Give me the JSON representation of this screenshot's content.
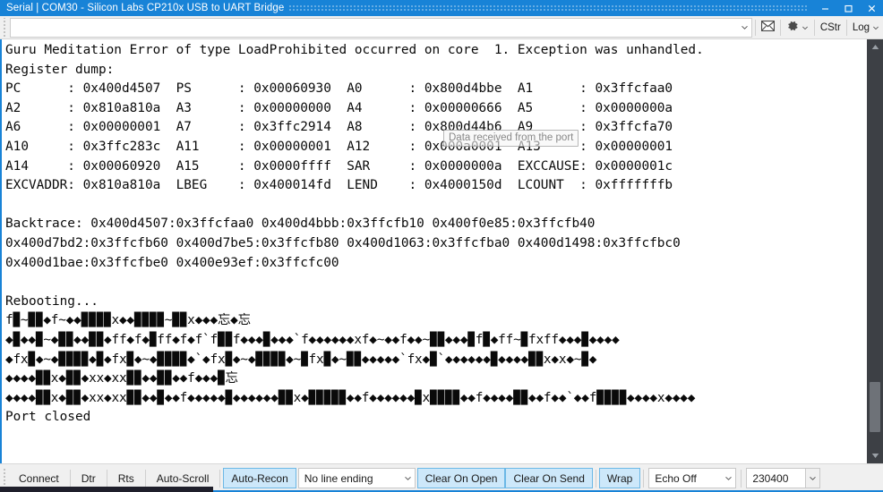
{
  "window": {
    "title": "Serial | COM30 - Silicon Labs CP210x USB to UART Bridge",
    "minimize_label": "‒",
    "maximize_label": "❐",
    "close_label": "✕"
  },
  "toolbar": {
    "send_value": "",
    "send_placeholder": "",
    "combo_arrow": "▾",
    "mail_icon_name": "envelope-icon",
    "gear_icon_name": "gear-icon",
    "gear_arrow": "▾",
    "cstr_label": "CStr",
    "log_label": "Log",
    "log_arrow": "▾"
  },
  "terminal": {
    "tooltip": "Data received from the port",
    "lines": [
      "Guru Meditation Error of type LoadProhibited occurred on core  1. Exception was unhandled.",
      "Register dump:",
      "PC      : 0x400d4507  PS      : 0x00060930  A0      : 0x800d4bbe  A1      : 0x3ffcfaa0",
      "A2      : 0x810a810a  A3      : 0x00000000  A4      : 0x00000666  A5      : 0x0000000a",
      "A6      : 0x00000001  A7      : 0x3ffc2914  A8      : 0x800d44b6  A9      : 0x3ffcfa70",
      "A10     : 0x3ffc283c  A11     : 0x00000001  A12     : 0x000a0001  A13     : 0x00000001",
      "A14     : 0x00060920  A15     : 0x0000ffff  SAR     : 0x0000000a  EXCCAUSE: 0x0000001c",
      "EXCVADDR: 0x810a810a  LBEG    : 0x400014fd  LEND    : 0x4000150d  LCOUNT  : 0xfffffffb",
      "",
      "Backtrace: 0x400d4507:0x3ffcfaa0 0x400d4bbb:0x3ffcfb10 0x400f0e85:0x3ffcfb40",
      "0x400d7bd2:0x3ffcfb60 0x400d7be5:0x3ffcfb80 0x400d1063:0x3ffcfba0 0x400d1498:0x3ffcfbc0",
      "0x400d1bae:0x3ffcfbe0 0x400e93ef:0x3ffcfc00",
      "",
      "Rebooting..."
    ],
    "garbled_lines": [
      "f▉~▉▉◆f~◆◆▉▉▉▉x◆◆▉▉▉▉~▉▉x◆◆◆忘◆忘",
      "◆▉◆◆▉~◆▉▉◆◆▉▉◆ff◆f◆▉ff◆f◆f`f▉▉f◆◆◆▉◆◆◆`f◆◆◆◆◆◆xf◆~◆◆f◆◆~▉▉◆◆◆▉f▉◆ff~▉fxff◆◆◆▉◆◆◆◆",
      "◆fx▉◆~◆▉▉▉▉◆▉◆fx▉◆~◆▉▉▉▉◆`◆fx▉◆~◆▉▉▉▉◆~▉fx▉◆~▉▉◆◆◆◆◆`fx◆▉`◆◆◆◆◆◆▉◆◆◆◆▉▉x◆x◆~▉◆",
      "◆◆◆◆▉▉x◆▉▉◆xx◆xx▉▉◆◆▉▉◆◆f◆◆◆▉忘",
      "◆◆◆◆▉▉x◆▉▉◆xx◆xx▉▉◆◆▉◆◆f◆◆◆◆◆▉◆◆◆◆◆◆▉▉x◆▉▉▉▉▉◆◆f◆◆◆◆◆◆▉x▉▉▉▉◆◆f◆◆◆◆▉▉◆◆f◆◆`◆◆f▉▉▉▉◆◆◆◆x◆◆◆◆"
    ],
    "final_line": "Port closed"
  },
  "scrollbar": {
    "up_arrow": "▲",
    "down_arrow": "▼"
  },
  "bottombar": {
    "buttons": [
      {
        "label": "Connect",
        "active": false,
        "name": "connect-button"
      },
      {
        "label": "Dtr",
        "active": false,
        "name": "dtr-button"
      },
      {
        "label": "Rts",
        "active": false,
        "name": "rts-button"
      },
      {
        "label": "Auto-Scroll",
        "active": false,
        "name": "auto-scroll-button"
      },
      {
        "label": "Auto-Recon",
        "active": true,
        "name": "auto-reconnect-button"
      }
    ],
    "line_ending": {
      "value": "No line ending",
      "arrow": "▾"
    },
    "clear_on_open": {
      "label": "Clear On Open",
      "active": true
    },
    "clear_on_send": {
      "label": "Clear On Send",
      "active": true
    },
    "wrap": {
      "label": "Wrap",
      "active": true
    },
    "echo": {
      "value": "Echo Off",
      "arrow": "▾"
    },
    "baud": {
      "value": "230400",
      "arrow": "▾"
    }
  },
  "colors": {
    "titlebar": "#1883d7",
    "accent": "#1883d7",
    "toolbar_bg": "#f0f0f0",
    "active_btn": "#cde8fa",
    "scrollbar_bg": "#3d4045",
    "scrollbar_thumb": "#6e7278",
    "terminal_text": "#0a0a0a"
  }
}
